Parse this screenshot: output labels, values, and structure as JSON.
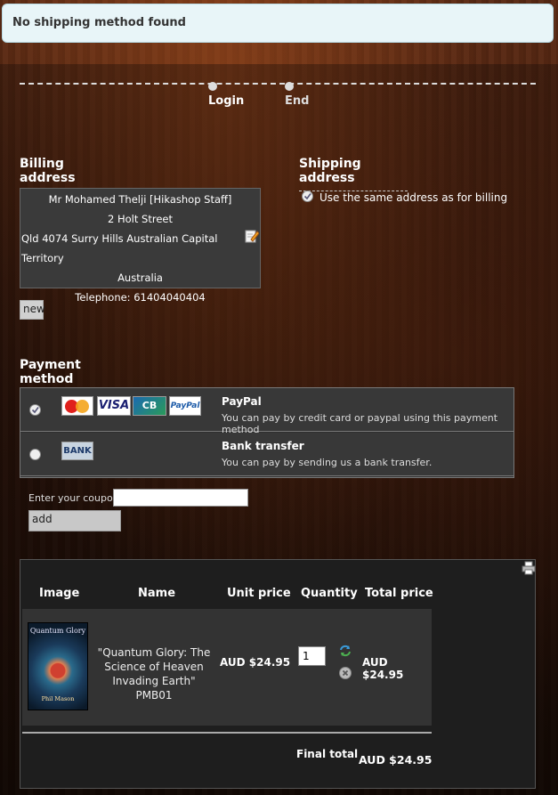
{
  "notice": {
    "text": "No shipping method found"
  },
  "steps": [
    {
      "label": "Login"
    },
    {
      "label": "End"
    }
  ],
  "billing": {
    "title": "Billing address",
    "lines": [
      "Mr Mohamed Thelji [Hikashop Staff]",
      "2 Holt Street",
      "Qld 4074 Surry Hills Australian Capital Territory",
      "Australia",
      "Telephone: 61404040404"
    ],
    "new_label": "new"
  },
  "shipping": {
    "title": "Shipping address",
    "same_label": "Use the same address as for billing"
  },
  "payment": {
    "title": "Payment method",
    "methods": [
      {
        "name": "PayPal",
        "description": "You can pay by credit card or paypal using this payment method",
        "selected": true
      },
      {
        "name": "Bank transfer",
        "description": "You can pay by sending us a bank transfer.",
        "selected": false
      }
    ],
    "logos": [
      "MasterCard",
      "VISA",
      "CB",
      "PayPal"
    ],
    "bank_logo": "BANK"
  },
  "coupon": {
    "label": "Enter your coupon",
    "add_label": "add"
  },
  "cart": {
    "headers": [
      "Image",
      "Name",
      "Unit price",
      "Quantity",
      "Total price"
    ],
    "item": {
      "name": "\"Quantum Glory: The Science of Heaven Invading Earth\" PMB01",
      "book_title": "Quantum Glory",
      "book_author": "Phil Mason",
      "unit_price": "AUD $24.95",
      "quantity": "1",
      "total": "AUD $24.95"
    },
    "final_total_label": "Final total",
    "final_total_value": "AUD $24.95"
  },
  "colors": {
    "notice_bg": "#e8f5f8",
    "panel_dark": "#383838"
  }
}
